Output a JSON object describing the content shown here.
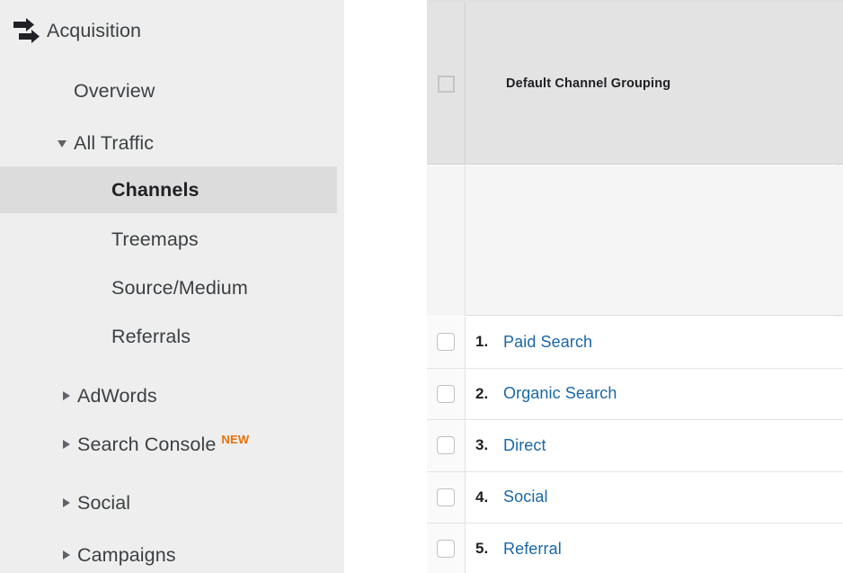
{
  "sidebar": {
    "section_icon": "double-arrow-icon",
    "section_title": "Acquisition",
    "items": [
      {
        "label": "Overview",
        "caret": "none",
        "indent": 82,
        "selected": false,
        "badge": ""
      },
      {
        "label": "All Traffic",
        "caret": "down",
        "indent": 82,
        "selected": false,
        "badge": ""
      },
      {
        "label": "Channels",
        "caret": "none",
        "indent": 124,
        "selected": true,
        "badge": ""
      },
      {
        "label": "Treemaps",
        "caret": "none",
        "indent": 124,
        "selected": false,
        "badge": ""
      },
      {
        "label": "Source/Medium",
        "caret": "none",
        "indent": 124,
        "selected": false,
        "badge": ""
      },
      {
        "label": "Referrals",
        "caret": "none",
        "indent": 124,
        "selected": false,
        "badge": ""
      },
      {
        "label": "AdWords",
        "caret": "right",
        "indent": 86,
        "selected": false,
        "badge": ""
      },
      {
        "label": "Search Console",
        "caret": "right",
        "indent": 86,
        "selected": false,
        "badge": "NEW"
      },
      {
        "label": "Social",
        "caret": "right",
        "indent": 86,
        "selected": false,
        "badge": ""
      },
      {
        "label": "Campaigns",
        "caret": "right",
        "indent": 86,
        "selected": false,
        "badge": ""
      }
    ]
  },
  "table": {
    "header_checkbox_state": "unchecked",
    "columns": [
      {
        "label": "Default Channel Grouping"
      }
    ],
    "rows": [
      {
        "index": "1.",
        "label": "Paid Search",
        "checked": false
      },
      {
        "index": "2.",
        "label": "Organic Search",
        "checked": false
      },
      {
        "index": "3.",
        "label": "Direct",
        "checked": false
      },
      {
        "index": "4.",
        "label": "Social",
        "checked": false
      },
      {
        "index": "5.",
        "label": "Referral",
        "checked": false
      }
    ]
  },
  "colors": {
    "sidebar_bg": "#eeeeee",
    "selected_bg": "#dcdcdc",
    "header_bg": "#e3e3e3",
    "link": "#1967a8",
    "badge_new": "#e8710a",
    "text": "#3c4043"
  }
}
